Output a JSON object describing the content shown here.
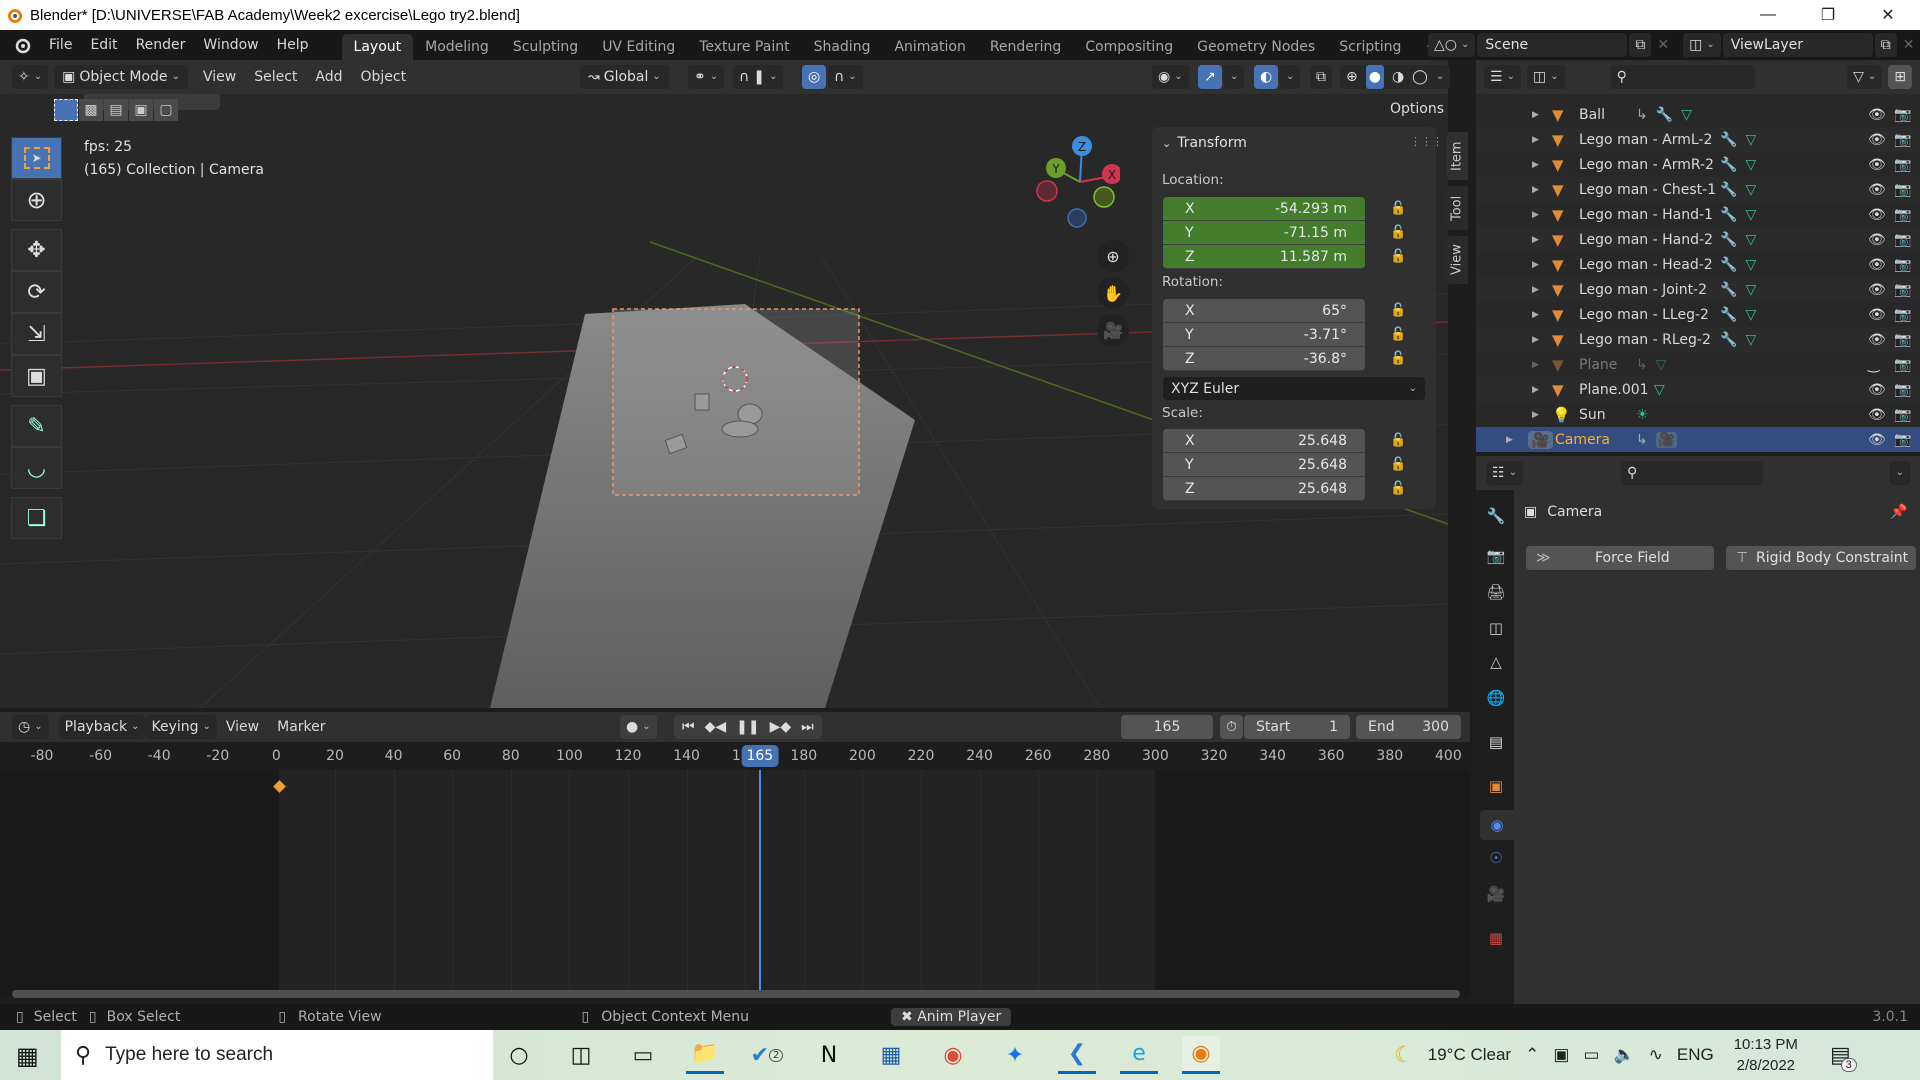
{
  "window": {
    "title": "Blender* [D:\\UNIVERSE\\FAB Academy\\Week2 excercise\\Lego try2.blend]",
    "controls": [
      "minimize",
      "restore",
      "close"
    ]
  },
  "menubar": {
    "items": [
      "File",
      "Edit",
      "Render",
      "Window",
      "Help"
    ],
    "workspaces": [
      "Layout",
      "Modeling",
      "Sculpting",
      "UV Editing",
      "Texture Paint",
      "Shading",
      "Animation",
      "Rendering",
      "Compositing",
      "Geometry Nodes",
      "Scripting"
    ],
    "active_workspace": "Layout",
    "add_workspace": "+",
    "scene": "Scene",
    "view_layer": "ViewLayer"
  },
  "viewport_header": {
    "mode": "Object Mode",
    "menus": [
      "View",
      "Select",
      "Add",
      "Object"
    ],
    "orientation": "Global",
    "options_label": "Options"
  },
  "viewport": {
    "fps": "fps: 25",
    "info": "(165) Collection | Camera",
    "gizmo_axes": [
      "X",
      "Y",
      "Z"
    ],
    "side_tabs": [
      "Item",
      "Tool",
      "View"
    ]
  },
  "transform_panel": {
    "title": "Transform",
    "location_label": "Location:",
    "location": [
      {
        "axis": "X",
        "value": "-54.293 m"
      },
      {
        "axis": "Y",
        "value": "-71.15 m"
      },
      {
        "axis": "Z",
        "value": "11.587 m"
      }
    ],
    "rotation_label": "Rotation:",
    "rotation": [
      {
        "axis": "X",
        "value": "65°"
      },
      {
        "axis": "Y",
        "value": "-3.71°"
      },
      {
        "axis": "Z",
        "value": "-36.8°"
      }
    ],
    "rotation_mode": "XYZ Euler",
    "scale_label": "Scale:",
    "scale": [
      {
        "axis": "X",
        "value": "25.648"
      },
      {
        "axis": "Y",
        "value": "25.648"
      },
      {
        "axis": "Z",
        "value": "25.648"
      }
    ]
  },
  "outliner": {
    "items": [
      {
        "name": "Ball",
        "type": "mesh"
      },
      {
        "name": "Lego man - ArmL-2",
        "type": "mesh"
      },
      {
        "name": "Lego man - ArmR-2",
        "type": "mesh"
      },
      {
        "name": "Lego man - Chest-1",
        "type": "mesh"
      },
      {
        "name": "Lego man - Hand-1",
        "type": "mesh"
      },
      {
        "name": "Lego man - Hand-2",
        "type": "mesh"
      },
      {
        "name": "Lego man - Head-2",
        "type": "mesh"
      },
      {
        "name": "Lego man - Joint-2",
        "type": "mesh"
      },
      {
        "name": "Lego man - LLeg-2",
        "type": "mesh"
      },
      {
        "name": "Lego man - RLeg-2",
        "type": "mesh"
      },
      {
        "name": "Plane",
        "type": "mesh",
        "hidden": true
      },
      {
        "name": "Plane.001",
        "type": "mesh"
      },
      {
        "name": "Sun",
        "type": "light"
      },
      {
        "name": "Camera",
        "type": "camera",
        "selected": true
      }
    ]
  },
  "properties": {
    "object_name": "Camera",
    "buttons": [
      "Force Field",
      "Rigid Body Constraint"
    ]
  },
  "timeline": {
    "menus": [
      "Playback",
      "Keying",
      "View",
      "Marker"
    ],
    "current_frame": "165",
    "start_label": "Start",
    "start": "1",
    "end_label": "End",
    "end": "300",
    "ticks": [
      "-80",
      "-60",
      "-40",
      "-20",
      "0",
      "20",
      "40",
      "60",
      "80",
      "100",
      "120",
      "140",
      "160",
      "180",
      "200",
      "220",
      "240",
      "260",
      "280",
      "300",
      "320",
      "340",
      "360",
      "380",
      "400"
    ]
  },
  "statusbar": {
    "select": "Select",
    "box_select": "Box Select",
    "rotate_view": "Rotate View",
    "context_menu": "Object Context Menu",
    "anim_player": "Anim Player",
    "version": "3.0.1"
  },
  "taskbar": {
    "search_placeholder": "Type here to search",
    "weather": "19°C  Clear",
    "language": "ENG",
    "time": "10:13 PM",
    "date": "2/8/2022",
    "notifications": "3",
    "badge_todo": "2"
  },
  "colors": {
    "accent_blue": "#4772b3",
    "location_green": "#447d2b",
    "object_orange": "#e08a3c",
    "selected_row": "#334d80"
  }
}
